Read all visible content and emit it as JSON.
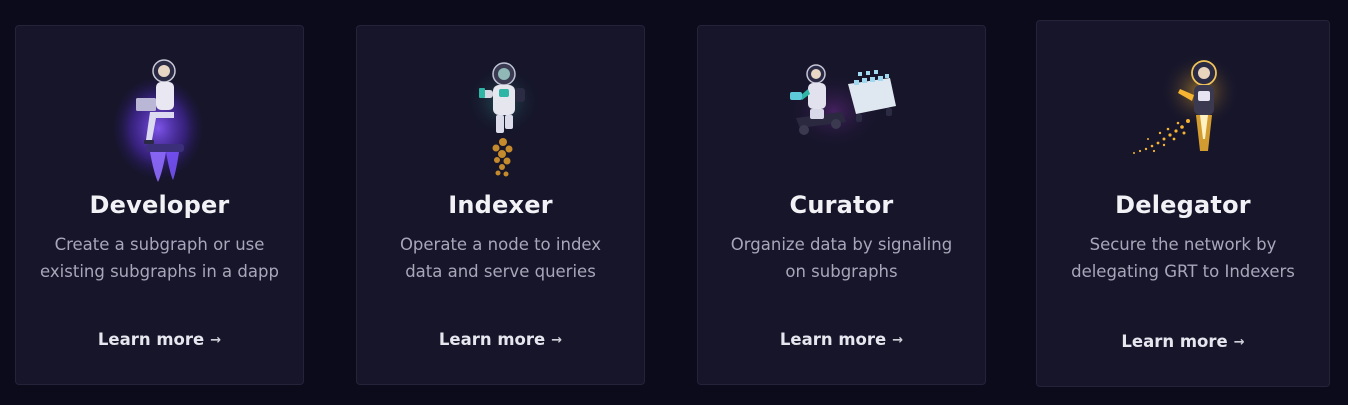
{
  "cards": [
    {
      "title": "Developer",
      "description": "Create a subgraph or use existing subgraphs in a dapp",
      "cta": "Learn more",
      "icon": "developer-astronaut-illustration"
    },
    {
      "title": "Indexer",
      "description": "Operate a node to index data and serve queries",
      "cta": "Learn more",
      "icon": "indexer-astronaut-illustration"
    },
    {
      "title": "Curator",
      "description": "Organize data by signaling on subgraphs",
      "cta": "Learn more",
      "icon": "curator-astronaut-illustration"
    },
    {
      "title": "Delegator",
      "description": "Secure the network by delegating GRT to Indexers",
      "cta": "Learn more",
      "icon": "delegator-astronaut-illustration"
    }
  ],
  "colors": {
    "background": "#0c0b1c",
    "card": "#16152a",
    "title": "#f2f2f6",
    "description": "#a8a7b9",
    "accent_purple": "#6f4cff",
    "accent_gold": "#f5b431"
  }
}
